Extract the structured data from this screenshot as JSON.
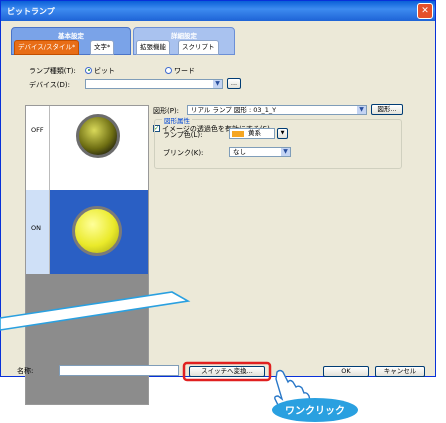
{
  "window": {
    "title": "ビットランプ",
    "close_glyph": "✕"
  },
  "tab_groups": [
    {
      "title": "基本設定",
      "tabs": [
        "デバイス/スタイル*",
        "文字*"
      ],
      "active": 0
    },
    {
      "title": "詳細設定",
      "tabs": [
        "拡張機能",
        "スクリプト"
      ]
    }
  ],
  "lamp_type": {
    "label": "ランプ種類(T):",
    "options": [
      "ビット",
      "ワード"
    ],
    "selected": "ビット"
  },
  "device": {
    "label": "デバイス(D):",
    "value": "",
    "browse_label": "..."
  },
  "shape": {
    "label": "図形(P):",
    "value": "リアル ランプ 図形 : 03_1_Y",
    "button_label": "図形..."
  },
  "transparency": {
    "label": "イメージの透過色を有効にする(S)",
    "checked": true
  },
  "shape_attr": {
    "title": "図形属性",
    "lamp_color": {
      "label": "ランプ色(L):",
      "value": "黄系",
      "swatch": "#f5a623"
    },
    "blink": {
      "label": "ブリンク(K):",
      "value": "なし"
    }
  },
  "states": [
    {
      "label": "OFF",
      "lamp_color": "#9a9a30"
    },
    {
      "label": "ON",
      "lamp_color": "#f2f23a"
    }
  ],
  "footer": {
    "name_label": "名称:",
    "name_value": "",
    "switch_button": "スイッチへ変換...",
    "ok": "OK",
    "cancel": "キャンセル"
  },
  "callout": {
    "text": "ワンクリック",
    "color": "#2aa0e0",
    "highlight": "#e02020"
  }
}
